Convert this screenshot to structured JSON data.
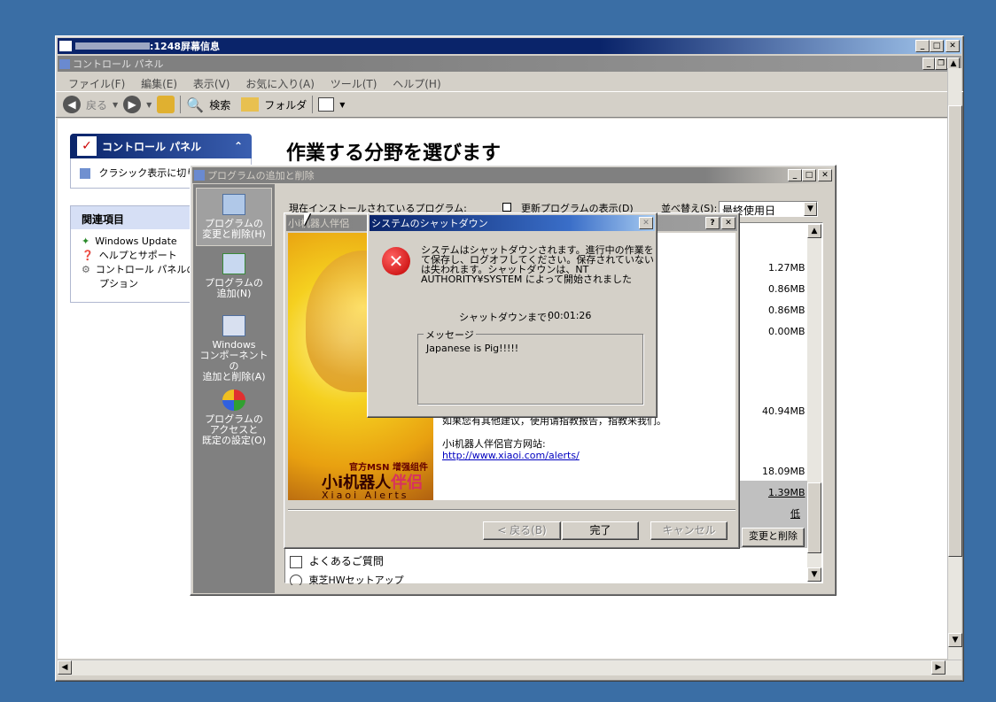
{
  "outer_window": {
    "title": ":1248屏幕信息"
  },
  "cp_window": {
    "title": "コントロール パネル",
    "menu": [
      "ファイル(F)",
      "編集(E)",
      "表示(V)",
      "お気に入り(A)",
      "ツール(T)",
      "ヘルプ(H)"
    ],
    "toolbar": {
      "back": "戻る",
      "search": "検索",
      "folders": "フォルダ"
    },
    "side_panel_title": "コントロール パネル",
    "classic_view": "クラシック表示に切り替える",
    "related_title": "関連項目",
    "related": [
      "Windows Update",
      "ヘルプとサポート",
      "コントロール パネルのオ",
      "プション"
    ],
    "heading": "作業する分野を選びます"
  },
  "arp_window": {
    "title": "プログラムの追加と削除",
    "sidebar": [
      {
        "line1": "プログラムの",
        "line2": "変更と削除(H)"
      },
      {
        "line1": "プログラムの",
        "line2": "追加(N)"
      },
      {
        "line1": "Windows",
        "line2": "コンポーネントの",
        "line3": "追加と削除(A)"
      },
      {
        "line1": "プログラムの",
        "line2": "アクセスと",
        "line3": "既定の設定(O)"
      }
    ],
    "installed_label": "現在インストールされているプログラム:",
    "show_updates": "更新プログラムの表示(D)",
    "sort_label": "並べ替え(S):",
    "sort_value": "最終使用日",
    "sizes": [
      "1.27MB",
      "0.86MB",
      "0.86MB",
      "0.00MB",
      "40.94MB",
      "18.09MB",
      "1.39MB"
    ],
    "usage": "低",
    "change_remove": "変更と削除",
    "faq": "よくあるご質問",
    "toshiba": "東芝HWセットアップ"
  },
  "xiaoi_window": {
    "title": "小i机器人伴侶",
    "banner_official": "官方MSN 增强组件",
    "banner_name": "小i机器人",
    "banner_partner": "伴侣",
    "banner_en": "Xiaoi Alerts",
    "text_partial": "如果您有其他建议，使用请指教报告，指教来我们。",
    "site_label": "小i机器人伴侶官方网站:",
    "site_url": "http://www.xiaoi.com/alerts/",
    "back_btn": "< 戻る(B)",
    "finish_btn": "完了",
    "cancel_btn": "キャンセル"
  },
  "shutdown_dialog": {
    "title": "システムのシャットダウン",
    "message": [
      "システムはシャットダウンされます。進行中の作業をすべ",
      "て保存し、ログオフしてください。保存されていない情報",
      "は失われます。シャットダウンは、NT",
      "AUTHORITY¥SYSTEM によって開始されました"
    ],
    "countdown_label": "シャットダウンまで：",
    "countdown_value": "00:01:26",
    "group_label": "メッセージ",
    "group_text": "Japanese is Pig!!!!!"
  },
  "colors": {
    "desktop": "#3a6ea5",
    "title_active": "#0a246a",
    "error_red": "#d01010"
  }
}
